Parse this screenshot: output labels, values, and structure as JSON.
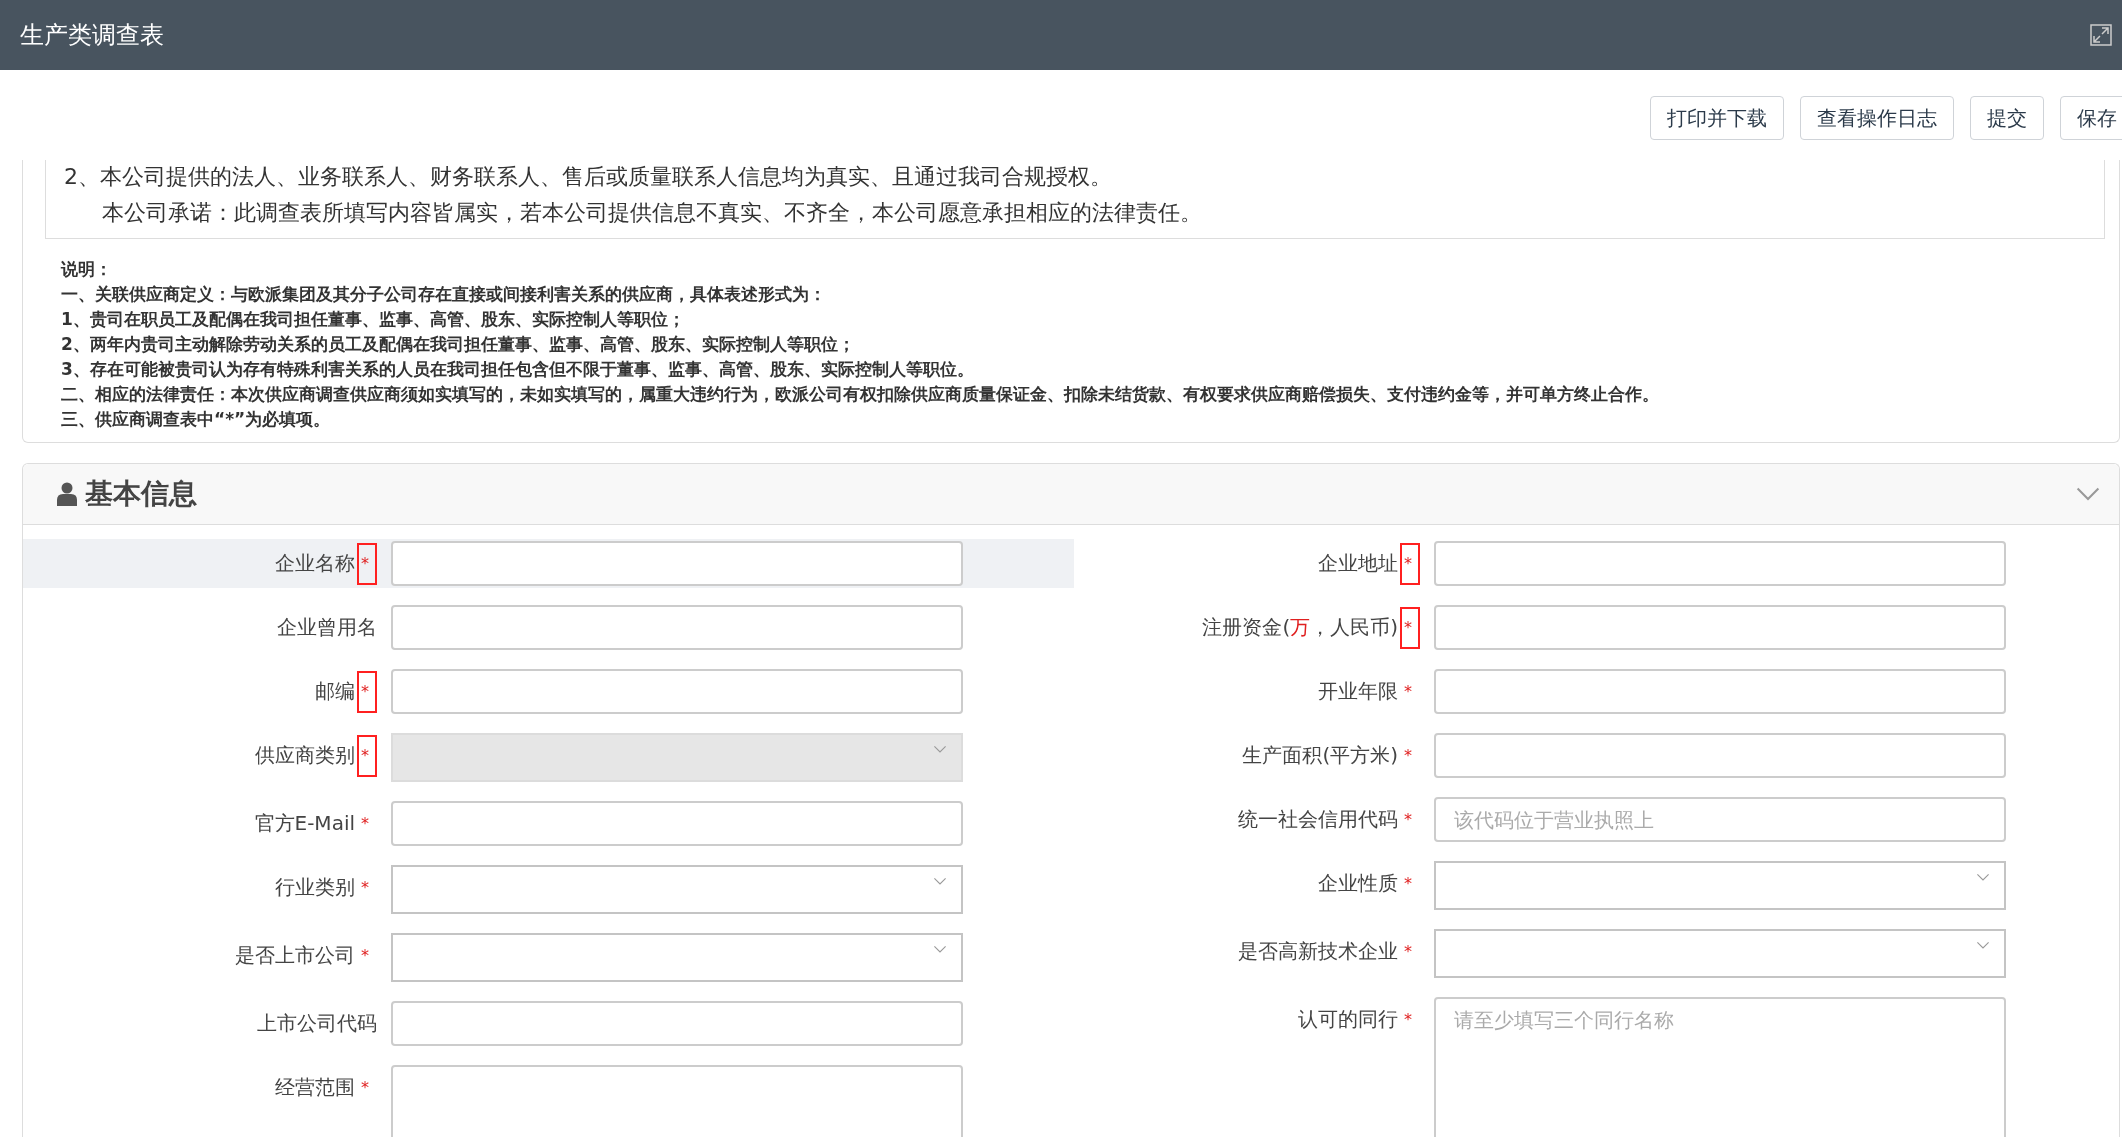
{
  "window": {
    "title": "生产类调查表"
  },
  "toolbar": {
    "buttons": [
      "打印并下载",
      "查看操作日志",
      "提交",
      "保存"
    ]
  },
  "commitment": {
    "item": "2、本公司提供的法人、业务联系人、财务联系人、售后或质量联系人信息均为真实、且通过我司合规授权。",
    "pledge": "本公司承诺：此调查表所填写内容皆属实，若本公司提供信息不真实、不齐全，本公司愿意承担相应的法律责任。"
  },
  "notes": [
    "说明：",
    "一、关联供应商定义：与欧派集团及其分子公司存在直接或间接利害关系的供应商，具体表述形式为：",
    "1、贵司在职员工及配偶在我司担任董事、监事、高管、股东、实际控制人等职位；",
    "2、两年内贵司主动解除劳动关系的员工及配偶在我司担任董事、监事、高管、股东、实际控制人等职位；",
    "3、存在可能被贵司认为存有特殊利害关系的人员在我司担任包含但不限于董事、监事、高管、股东、实际控制人等职位。",
    "二、相应的法律责任：本次供应商调查供应商须如实填写的，未如实填写的，属重大违约行为，欧派公司有权扣除供应商质量保证金、扣除未结货款、有权要求供应商赔偿损失、支付违约金等，并可单方终止合作。",
    "三、供应商调查表中“*”为必填项。"
  ],
  "section": {
    "title": "基本信息",
    "expanded": true,
    "left_fields": [
      {
        "kind": "text",
        "label": [
          {
            "text": "企业名称",
            "red": false
          }
        ],
        "required": "*",
        "marked": true,
        "hovered": true
      },
      {
        "kind": "text",
        "label": [
          {
            "text": "企业曾用名",
            "red": false
          }
        ],
        "hovered": false
      },
      {
        "kind": "text",
        "label": [
          {
            "text": "邮编",
            "red": false
          }
        ],
        "required": "*",
        "marked": true,
        "hovered": false
      },
      {
        "kind": "select",
        "label": [
          {
            "text": "供应商类别",
            "red": false
          }
        ],
        "required": "*",
        "marked": true,
        "hovered": false,
        "disabled": true
      },
      {
        "kind": "text",
        "label": [
          {
            "text": "官方E-Mail",
            "red": false
          }
        ],
        "required": "*",
        "marked": false,
        "hovered": false
      },
      {
        "kind": "select",
        "label": [
          {
            "text": "行业类别",
            "red": false
          }
        ],
        "required": "*",
        "marked": false,
        "hovered": false,
        "disabled": false
      },
      {
        "kind": "select",
        "label": [
          {
            "text": "是否上市公司",
            "red": false
          }
        ],
        "required": "*",
        "marked": false,
        "hovered": false,
        "disabled": false
      },
      {
        "kind": "text",
        "label": [
          {
            "text": "上市公司代码",
            "red": false
          }
        ],
        "hovered": false
      },
      {
        "kind": "textarea",
        "label": [
          {
            "text": "经营范围",
            "red": false
          }
        ],
        "required": "*",
        "marked": false,
        "hovered": false
      }
    ],
    "right_fields": [
      {
        "kind": "text",
        "label": [
          {
            "text": "企业地址",
            "red": false
          }
        ],
        "required": "*",
        "marked": true,
        "hovered": false
      },
      {
        "kind": "text",
        "label": [
          {
            "text": "注册资金(",
            "red": false
          },
          {
            "text": "万",
            "red": true
          },
          {
            "text": "，人民币)",
            "red": false
          }
        ],
        "required": "*",
        "marked": true,
        "hovered": false
      },
      {
        "kind": "text",
        "label": [
          {
            "text": "开业年限",
            "red": false
          }
        ],
        "required": "*",
        "marked": false,
        "hovered": false
      },
      {
        "kind": "text",
        "label": [
          {
            "text": "生产面积(平方米)",
            "red": false
          }
        ],
        "required": "*",
        "marked": false,
        "hovered": false
      },
      {
        "kind": "text",
        "label": [
          {
            "text": "统一社会信用代码",
            "red": false
          }
        ],
        "required": "*",
        "marked": false,
        "hovered": false,
        "placeholder": "该代码位于营业执照上"
      },
      {
        "kind": "select",
        "label": [
          {
            "text": "企业性质",
            "red": false
          }
        ],
        "required": "*",
        "marked": false,
        "hovered": false,
        "disabled": false
      },
      {
        "kind": "select",
        "label": [
          {
            "text": "是否高新技术企业",
            "red": false
          }
        ],
        "required": "*",
        "marked": false,
        "hovered": false,
        "disabled": false
      },
      {
        "kind": "textarea",
        "label": [
          {
            "text": "认可的同行",
            "red": false
          }
        ],
        "required": "*",
        "marked": false,
        "hovered": false,
        "placeholder": "请至少填写三个同行名称"
      }
    ]
  }
}
